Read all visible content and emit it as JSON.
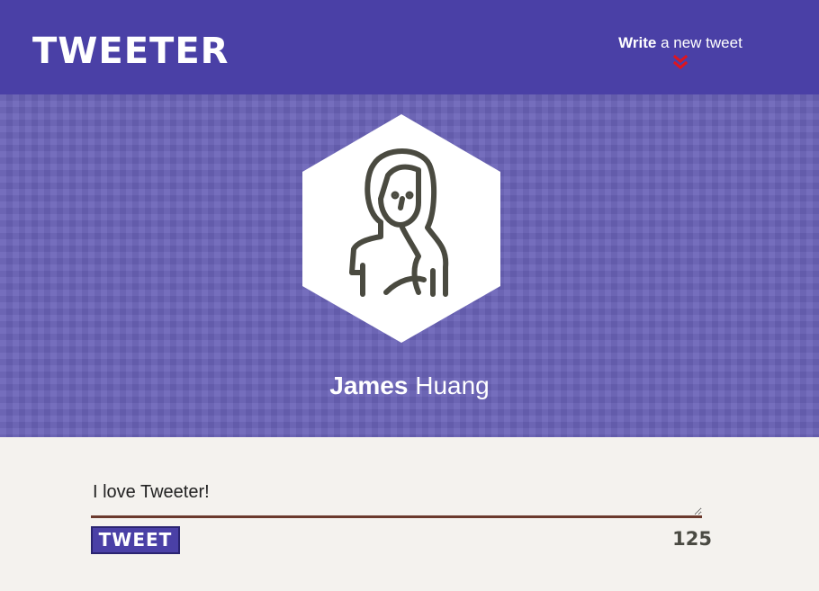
{
  "navbar": {
    "logo": "TWEETER",
    "compose_strong": "Write",
    "compose_light": " a new tweet",
    "compose_icon": "double-chevron-down-icon",
    "accent_color": "#4a40a6",
    "chevron_color": "#e0141e"
  },
  "profile": {
    "avatar_icon": "woman-avatar-icon",
    "first_name": "James",
    "last_name": "Huang"
  },
  "composer": {
    "text": "I love Tweeter!",
    "button_label": "TWEET",
    "char_count": "125"
  }
}
